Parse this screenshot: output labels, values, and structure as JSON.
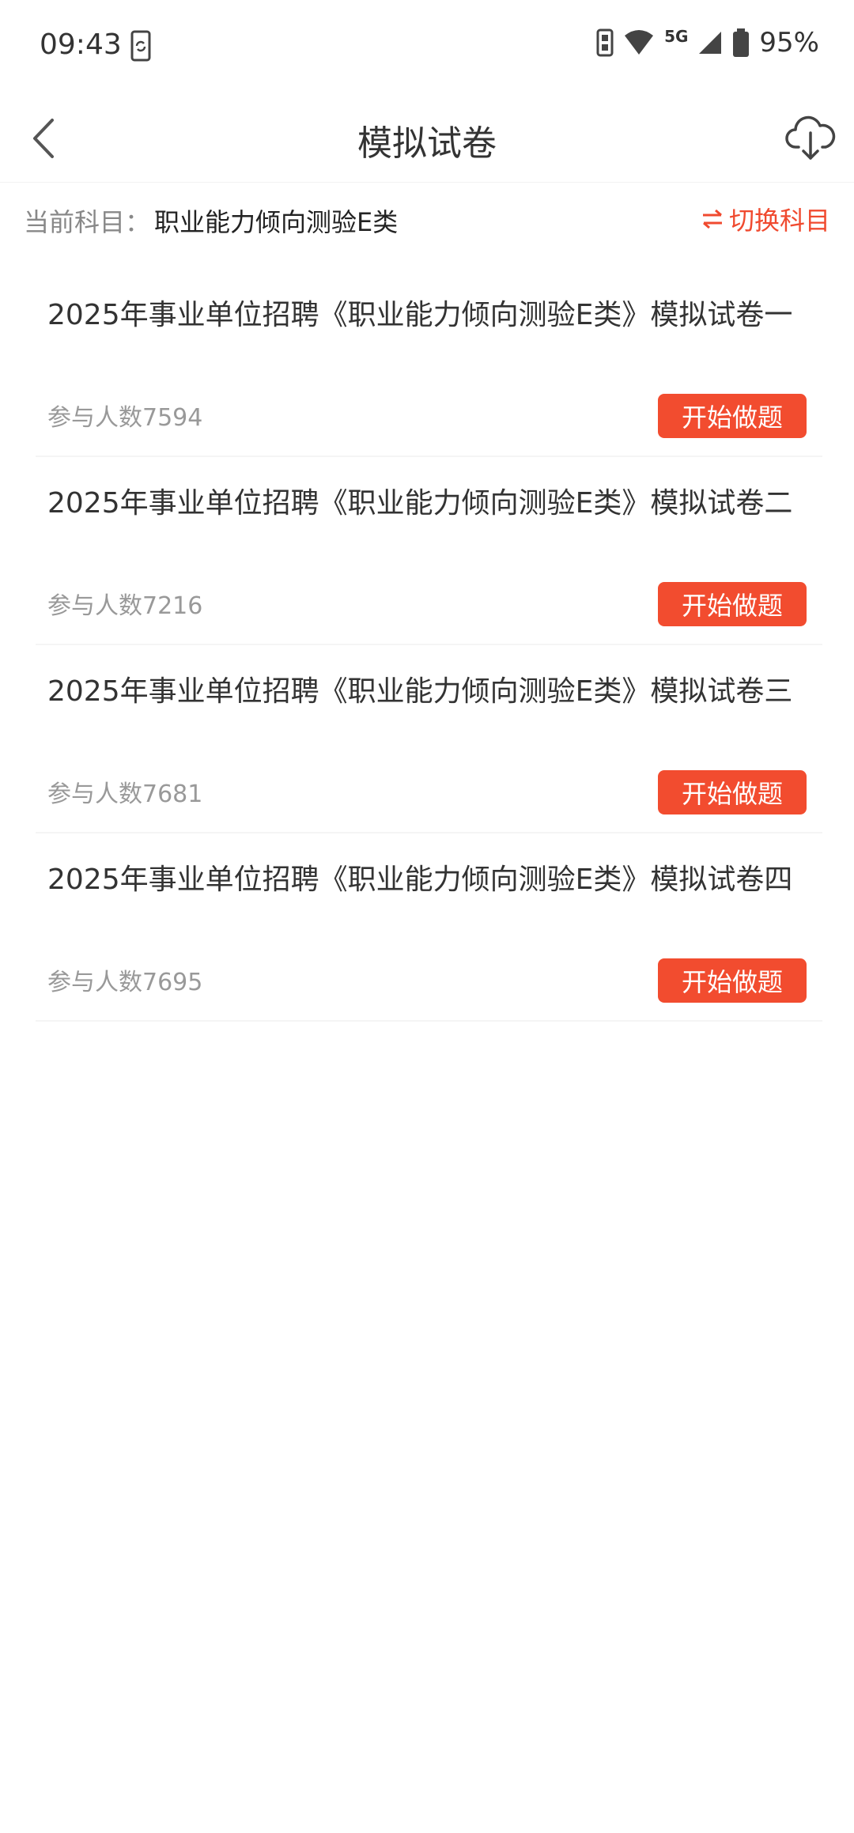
{
  "status_bar": {
    "time": "09:43",
    "network": "5G",
    "battery": "95%"
  },
  "header": {
    "title": "模拟试卷",
    "back_icon": "chevron-left-icon",
    "download_icon": "cloud-download-icon"
  },
  "subject": {
    "label": "当前科目：",
    "value": "职业能力倾向测验E类",
    "switch_label": "切换科目"
  },
  "papers": [
    {
      "title": "2025年事业单位招聘《职业能力倾向测验E类》模拟试卷一",
      "count": "参与人数7594",
      "button": "开始做题"
    },
    {
      "title": "2025年事业单位招聘《职业能力倾向测验E类》模拟试卷二",
      "count": "参与人数7216",
      "button": "开始做题"
    },
    {
      "title": "2025年事业单位招聘《职业能力倾向测验E类》模拟试卷三",
      "count": "参与人数7681",
      "button": "开始做题"
    },
    {
      "title": "2025年事业单位招聘《职业能力倾向测验E类》模拟试卷四",
      "count": "参与人数7695",
      "button": "开始做题"
    }
  ],
  "colors": {
    "accent": "#f24c2f"
  }
}
